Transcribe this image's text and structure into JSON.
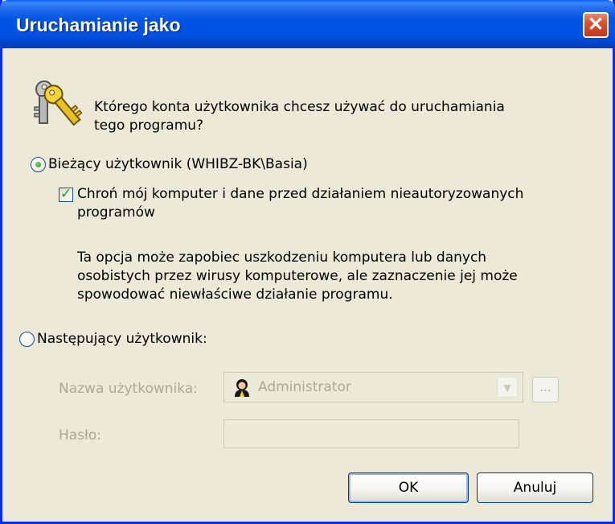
{
  "window": {
    "title": "Uruchamianie jako",
    "close_glyph": "✕"
  },
  "prompt": {
    "line1": "Którego konta użytkownika chcesz używać do uruchamiania",
    "line2": "tego programu?"
  },
  "current_user": {
    "label": "Bieżący użytkownik (WHIBZ-BK\\Basia)",
    "selected": true,
    "protect_checkbox": {
      "checked": true,
      "line1": "Chroń mój komputer i dane przed działaniem nieautoryzowanych",
      "line2": "programów"
    },
    "note": {
      "line1": "Ta opcja może zapobiec uszkodzeniu komputera lub danych",
      "line2": "osobistych przez wirusy komputerowe, ale zaznaczenie jej może",
      "line3": "spowodować niewłaściwe działanie programu."
    }
  },
  "other_user": {
    "label": "Następujący użytkownik:",
    "selected": false,
    "username_label": "Nazwa użytkownika:",
    "username_value": "Administrator",
    "browse_label": "...",
    "password_label": "Hasło:",
    "password_value": ""
  },
  "buttons": {
    "ok": "OK",
    "cancel": "Anuluj"
  },
  "icons": {
    "keys": "keys-icon",
    "user": "user-account-icon",
    "dropdown": "chevron-down-icon"
  },
  "colors": {
    "title_blue": "#0054e3",
    "frame_blue": "#0831d9",
    "dialog_bg": "#ece9d8",
    "disabled_text": "#aca899",
    "close_red": "#d9532f"
  }
}
